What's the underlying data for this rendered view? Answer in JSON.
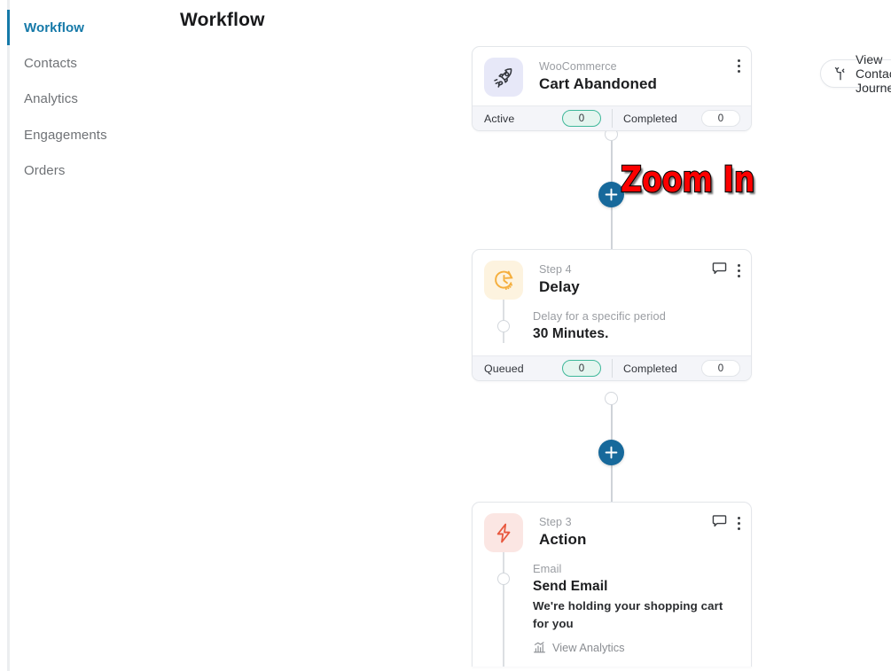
{
  "page": {
    "title": "Workflow",
    "background": "#ffffff",
    "accent_blue": "#17699b",
    "sidebar_active_color": "#1579a8"
  },
  "sidebar": {
    "items": [
      {
        "label": "Workflow",
        "active": true
      },
      {
        "label": "Contacts",
        "active": false
      },
      {
        "label": "Analytics",
        "active": false
      },
      {
        "label": "Engagements",
        "active": false
      },
      {
        "label": "Orders",
        "active": false
      }
    ]
  },
  "toolbar": {
    "journey_button_label": "View Contact Journey",
    "journey_button_icon": "branch-icon",
    "zoom_controls": [
      {
        "name": "zoom-in",
        "glyph": "+"
      },
      {
        "name": "zoom-out",
        "glyph": "−"
      },
      {
        "name": "fit-view",
        "glyph": "fit-corners-icon"
      },
      {
        "name": "expand-view",
        "glyph": "expand-arrows-icon"
      }
    ]
  },
  "annotation": {
    "label": "Zoom In",
    "color": "#fb0000",
    "outline_color": "#000000",
    "arrow_color": "#ee0000",
    "points_to": "zoom-in"
  },
  "workflow": {
    "nodes": [
      {
        "id": "trigger",
        "icon": "rocket-icon",
        "icon_bg": "#e7e8f8",
        "icon_color": "#33363d",
        "head_sub": "WooCommerce",
        "head_title": "Cart Abandoned",
        "has_comment_icon": false,
        "has_menu_icon": true,
        "body": null,
        "stats": [
          {
            "label": "Active",
            "value": "0",
            "highlight": true
          },
          {
            "label": "Completed",
            "value": "0",
            "highlight": false
          }
        ]
      },
      {
        "id": "delay",
        "icon": "clock-icon",
        "icon_bg": "#fdf3df",
        "icon_color": "#f5ae3c",
        "head_sub": "Step 4",
        "head_title": "Delay",
        "has_comment_icon": true,
        "has_menu_icon": true,
        "body": {
          "sub": "Delay for a specific period",
          "title": "30 Minutes.",
          "desc": null,
          "analytics_label": null
        },
        "stats": [
          {
            "label": "Queued",
            "value": "0",
            "highlight": true
          },
          {
            "label": "Completed",
            "value": "0",
            "highlight": false
          }
        ]
      },
      {
        "id": "action",
        "icon": "bolt-icon",
        "icon_bg": "#fbe6e3",
        "icon_color": "#e8563c",
        "head_sub": "Step 3",
        "head_title": "Action",
        "has_comment_icon": true,
        "has_menu_icon": true,
        "body": {
          "sub": "Email",
          "title": "Send Email",
          "desc": "We're holding your shopping cart for you",
          "analytics_label": "View Analytics",
          "analytics_icon": "bar-chart-icon"
        },
        "stats": []
      }
    ],
    "add_buttons": [
      {
        "name": "add-step-between-trigger-and-delay",
        "glyph": "+"
      },
      {
        "name": "add-step-between-delay-and-action",
        "glyph": "+"
      }
    ]
  }
}
